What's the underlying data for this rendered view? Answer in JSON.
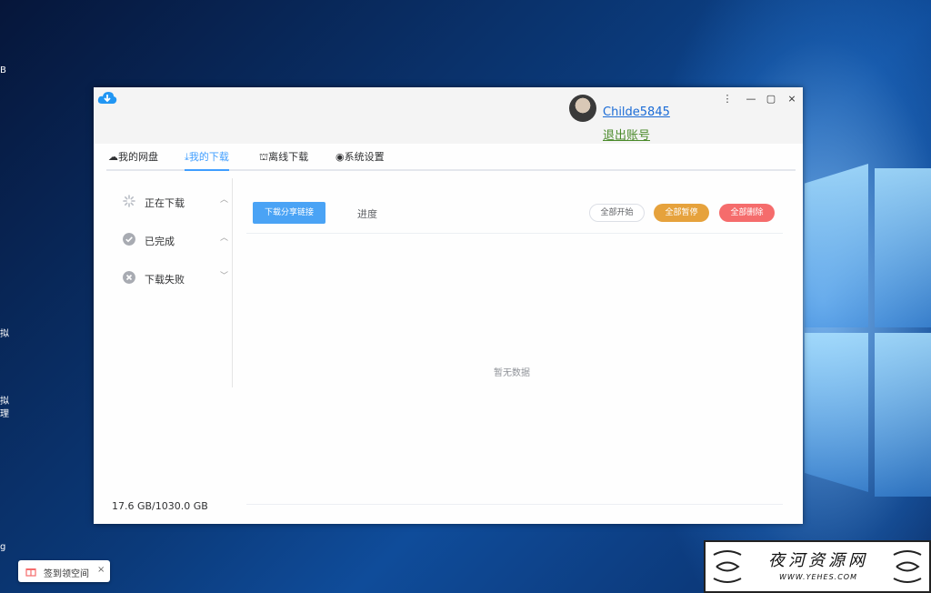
{
  "desktop": {
    "edge_texts": [
      "B",
      "拟",
      "拟",
      "理",
      "g"
    ]
  },
  "window": {
    "user": {
      "name": "Childe5845",
      "logout": "退出账号"
    },
    "controls": {
      "menu": "⋮",
      "minimize": "—",
      "maximize": "▢",
      "close": "⨯"
    }
  },
  "tabs": [
    {
      "icon": "☁",
      "label": "我的网盘"
    },
    {
      "icon": "⤓",
      "label": "我的下载"
    },
    {
      "icon": "⛫",
      "label": "离线下载"
    },
    {
      "icon": "◉",
      "label": "系统设置"
    }
  ],
  "sidebar": {
    "items": [
      {
        "label": "正在下载",
        "caret": "︿"
      },
      {
        "label": "已完成",
        "caret": "︿"
      },
      {
        "label": "下载失败",
        "caret": "﹀"
      }
    ]
  },
  "toolbar": {
    "share_link": "下载分享链接",
    "progress": "进度",
    "start_all": "全部开始",
    "pause_all": "全部暂停",
    "delete_all": "全部删除"
  },
  "content": {
    "empty": "暂无数据",
    "storage": "17.6 GB/1030.0 GB"
  },
  "toast": {
    "label": "签到领空间",
    "close": "×"
  },
  "watermark": {
    "title": "夜河资源网",
    "url": "WWW.YEHES.COM"
  },
  "colors": {
    "accent": "#409eff",
    "primary_button": "#4aa3f5",
    "pause_button": "#e6a23c",
    "delete_button": "#f56c6c"
  }
}
